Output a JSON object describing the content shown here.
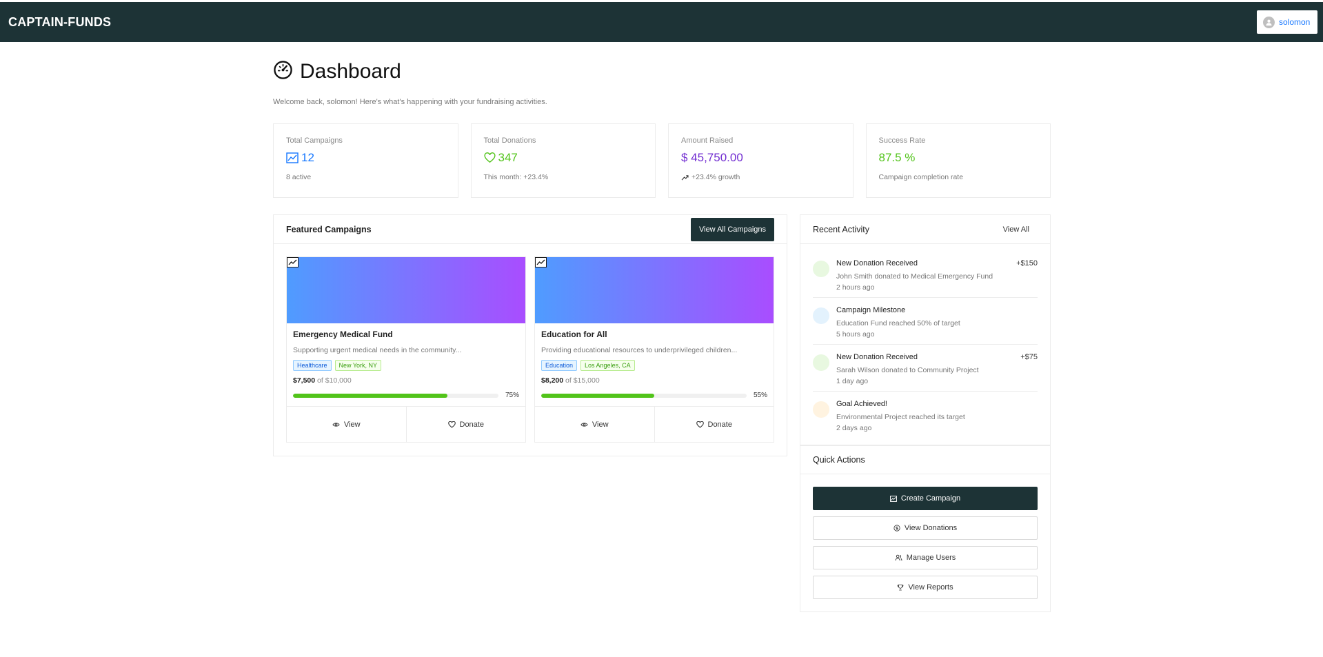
{
  "app": {
    "brand": "CAPTAIN-FUNDS",
    "user": "solomon"
  },
  "page": {
    "title": "Dashboard",
    "subtitle": "Welcome back, solomon! Here's what's happening with your fundraising activities."
  },
  "stats": [
    {
      "label": "Total Campaigns",
      "value": "12",
      "sub": "8 active",
      "color": "#1677ff",
      "icon": "chart-line-icon"
    },
    {
      "label": "Total Donations",
      "value": "347",
      "sub": "This month: +23.4%",
      "color": "#52c41a",
      "icon": "heart-icon"
    },
    {
      "label": "Amount Raised",
      "value": "$ 45,750.00",
      "sub": "+23.4% growth",
      "color": "#722ed1",
      "icon": "trend-up-icon"
    },
    {
      "label": "Success Rate",
      "value": "87.5 %",
      "sub": "Campaign completion rate",
      "color": "#52c41a",
      "icon": ""
    }
  ],
  "featured": {
    "title": "Featured Campaigns",
    "view_all": "View All Campaigns",
    "campaigns": [
      {
        "title": "Emergency Medical Fund",
        "desc": "Supporting urgent medical needs in the community...",
        "category": "Healthcare",
        "location": "New York, NY",
        "raised": "$7,500",
        "goal": "of $10,000",
        "progress": 75,
        "pct": "75%",
        "view": "View",
        "donate": "Donate"
      },
      {
        "title": "Education for All",
        "desc": "Providing educational resources to underprivileged children...",
        "category": "Education",
        "location": "Los Angeles, CA",
        "raised": "$8,200",
        "goal": "of $15,000",
        "progress": 55,
        "pct": "55%",
        "view": "View",
        "donate": "Donate"
      }
    ]
  },
  "activity": {
    "title": "Recent Activity",
    "view_all": "View All",
    "items": [
      {
        "title": "New Donation Received",
        "desc": "John Smith donated to Medical Emergency Fund",
        "time": "2 hours ago",
        "amount": "+$150",
        "color": "#e8f8e0"
      },
      {
        "title": "Campaign Milestone",
        "desc": "Education Fund reached 50% of target",
        "time": "5 hours ago",
        "amount": "",
        "color": "#e3f2fd"
      },
      {
        "title": "New Donation Received",
        "desc": "Sarah Wilson donated to Community Project",
        "time": "1 day ago",
        "amount": "+$75",
        "color": "#e8f8e0"
      },
      {
        "title": "Goal Achieved!",
        "desc": "Environmental Project reached its target",
        "time": "2 days ago",
        "amount": "",
        "color": "#fff3e0"
      }
    ]
  },
  "quick_actions": {
    "title": "Quick Actions",
    "create": "Create Campaign",
    "donations": "View Donations",
    "users": "Manage Users",
    "reports": "View Reports"
  }
}
